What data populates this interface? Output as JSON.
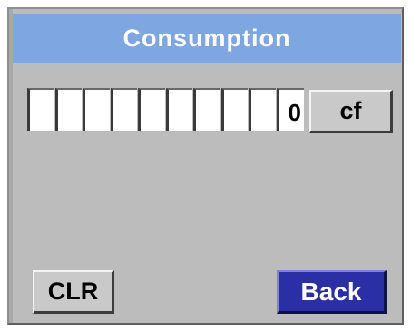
{
  "screen": {
    "title": "Consumption"
  },
  "counter": {
    "digits": [
      "",
      "",
      "",
      "",
      "",
      "",
      "",
      "",
      "",
      "0"
    ],
    "unit_label": "cf"
  },
  "actions": {
    "clear_label": "CLR",
    "back_label": "Back"
  },
  "colors": {
    "title_bar": "#7ea6e0",
    "screen_bg": "#bcbcbc",
    "back_button": "#2b2fa6",
    "button_bg": "#c9c9c9"
  }
}
